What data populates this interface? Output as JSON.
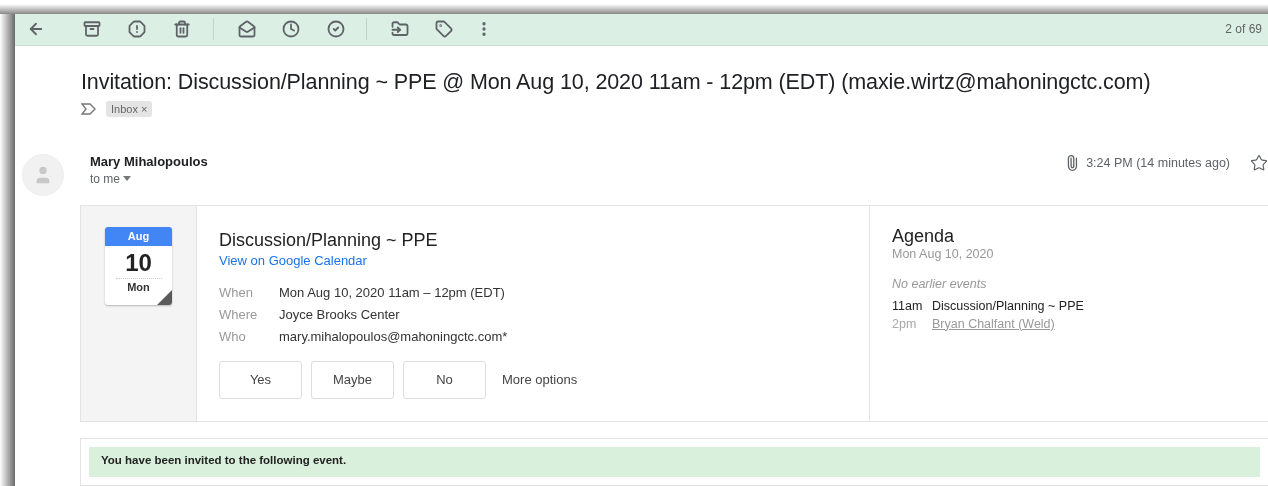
{
  "toolbar": {
    "counter": "2 of 69"
  },
  "email": {
    "subject": "Invitation: Discussion/Planning ~ PPE @ Mon Aug 10, 2020 11am - 12pm (EDT) (maxie.wirtz@mahoningctc.com)",
    "labels": [
      {
        "label": "Inbox",
        "remove": "×"
      }
    ],
    "sender": "Mary Mihalopoulos",
    "recipient": "to me",
    "time": "3:24 PM (14 minutes ago)",
    "starred": false
  },
  "invite": {
    "month": "Aug",
    "day": "10",
    "weekday": "Mon",
    "title": "Discussion/Planning ~ PPE",
    "calendar_link": "View on Google Calendar",
    "details": [
      {
        "label": "When",
        "value": "Mon Aug 10, 2020 11am – 12pm (EDT)"
      },
      {
        "label": "Where",
        "value": "Joyce Brooks Center"
      },
      {
        "label": "Who",
        "value": "mary.mihalopoulos@mahoningctc.com*"
      }
    ],
    "buttons": [
      "Yes",
      "Maybe",
      "No"
    ],
    "more_options": "More options",
    "agenda": {
      "title": "Agenda",
      "date": "Mon Aug 10, 2020",
      "note": "No earlier events",
      "events": [
        {
          "time": "11am",
          "title": "Discussion/Planning ~ PPE",
          "kind": "current"
        },
        {
          "time": "2pm",
          "title": "Bryan Chalfant (Weld)",
          "kind": "link"
        }
      ]
    }
  },
  "banner": "You have been invited to the following event."
}
